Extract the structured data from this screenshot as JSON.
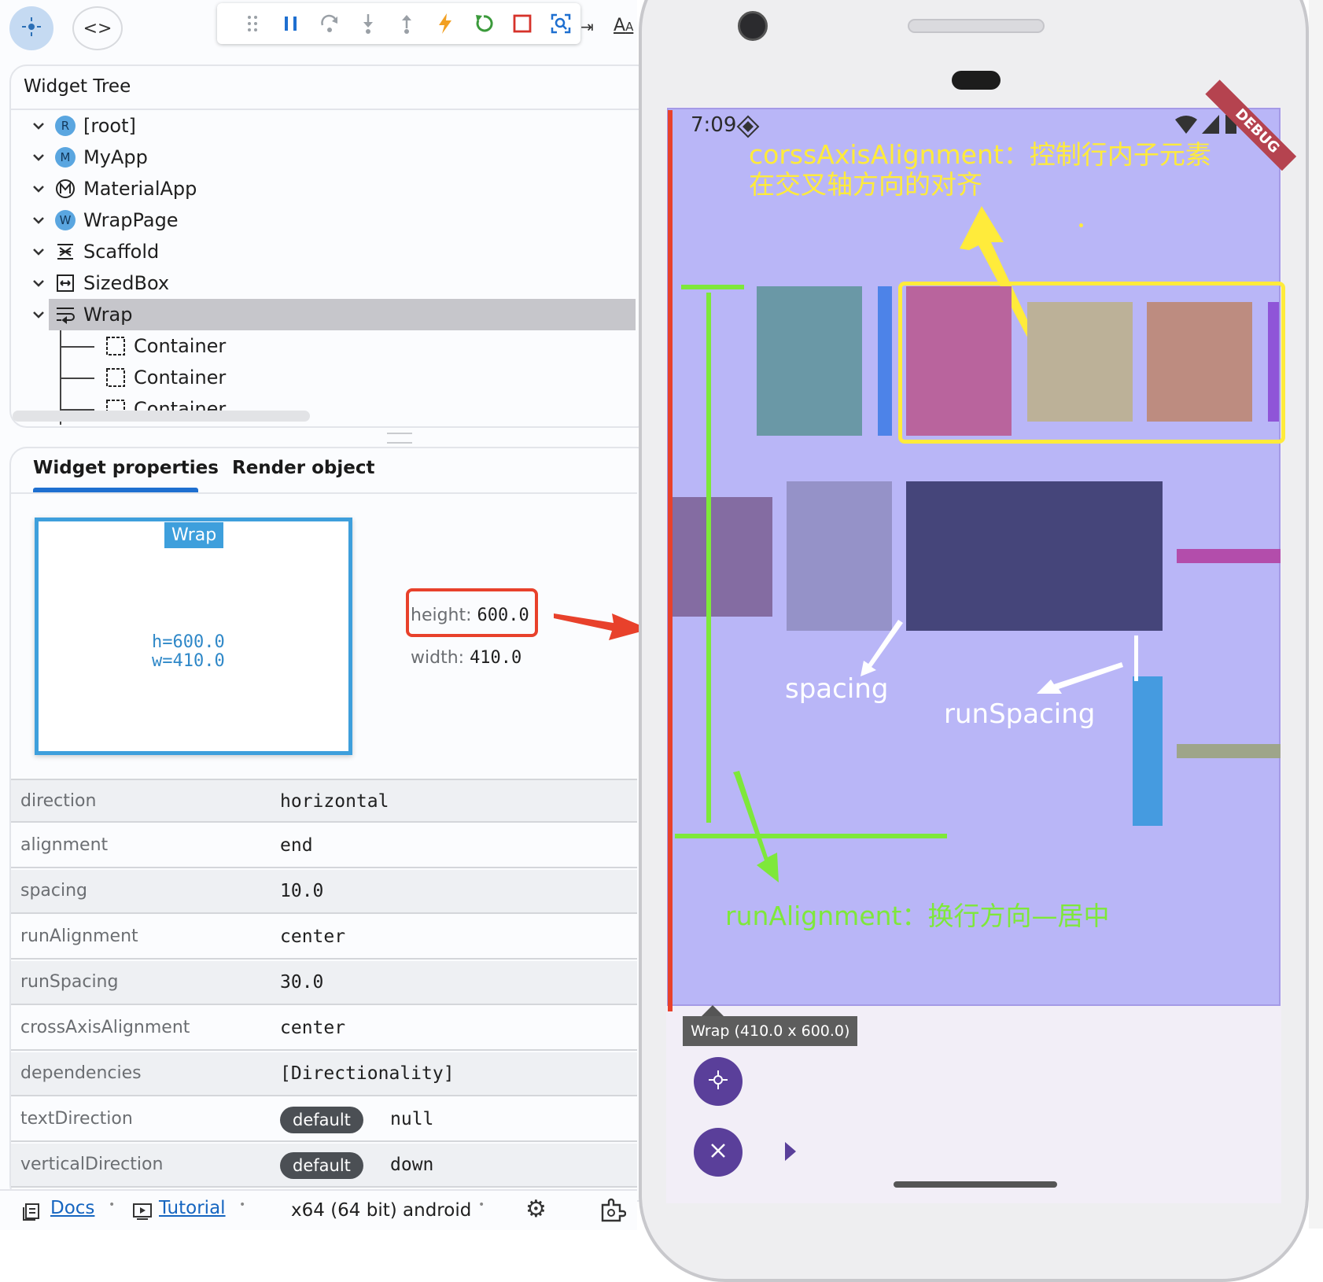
{
  "toolbar": {
    "icons": [
      "drag-handle-icon",
      "pause-icon",
      "step-over-icon",
      "step-into-icon",
      "step-out-icon",
      "hot-reload-icon",
      "hot-restart-icon",
      "stop-icon",
      "inspect-icon"
    ]
  },
  "tree": {
    "title": "Widget Tree",
    "nodes": [
      {
        "label": "[root]",
        "badge": "R"
      },
      {
        "label": "MyApp",
        "badge": "M"
      },
      {
        "label": "MaterialApp",
        "badge": "M"
      },
      {
        "label": "WrapPage",
        "badge": "W"
      },
      {
        "label": "Scaffold"
      },
      {
        "label": "SizedBox"
      },
      {
        "label": "Wrap",
        "selected": true
      },
      {
        "label": "Container"
      },
      {
        "label": "Container"
      },
      {
        "label": "Container"
      }
    ]
  },
  "tabs": {
    "widget_properties": "Widget properties",
    "render_object": "Render object"
  },
  "layout_box": {
    "title": "Wrap",
    "h": "h=600.0",
    "w": "w=410.0",
    "height_label": "height:",
    "height_value": "600.0",
    "width_label": "width:",
    "width_value": "410.0"
  },
  "properties": [
    {
      "name": "direction",
      "value": "horizontal"
    },
    {
      "name": "alignment",
      "value": "end"
    },
    {
      "name": "spacing",
      "value": "10.0"
    },
    {
      "name": "runAlignment",
      "value": "center"
    },
    {
      "name": "runSpacing",
      "value": "30.0"
    },
    {
      "name": "crossAxisAlignment",
      "value": "center"
    },
    {
      "name": "dependencies",
      "value": "[Directionality]"
    },
    {
      "name": "textDirection",
      "pill": "default",
      "value": "null"
    },
    {
      "name": "verticalDirection",
      "pill": "default",
      "value": "down"
    }
  ],
  "footer": {
    "docs": "Docs",
    "tutorial": "Tutorial",
    "platform": "x64 (64 bit) android",
    "sep": "•"
  },
  "phone": {
    "time": "7:09",
    "debug_banner": "DEBUG",
    "tooltip": "Wrap (410.0 x 600.0)",
    "annotations": {
      "cross_axis": "corssAxisAlignment：控制行内子元素在交叉轴方向的对齐",
      "cross_axis_line1": "corssAxisAlignment：控制行内子元素",
      "cross_axis_line2": "在交叉轴方向的对齐",
      "spacing": "spacing",
      "run_spacing": "runSpacing",
      "run_alignment": "runAlignment：换行方向—居中"
    },
    "colors": {
      "wrap_bg": "#b9b6f7",
      "annotation_yellow": "#ffeb3b",
      "annotation_green": "#7ee83a",
      "annotation_red": "#e8412b",
      "fab": "#5a3f9a"
    }
  }
}
